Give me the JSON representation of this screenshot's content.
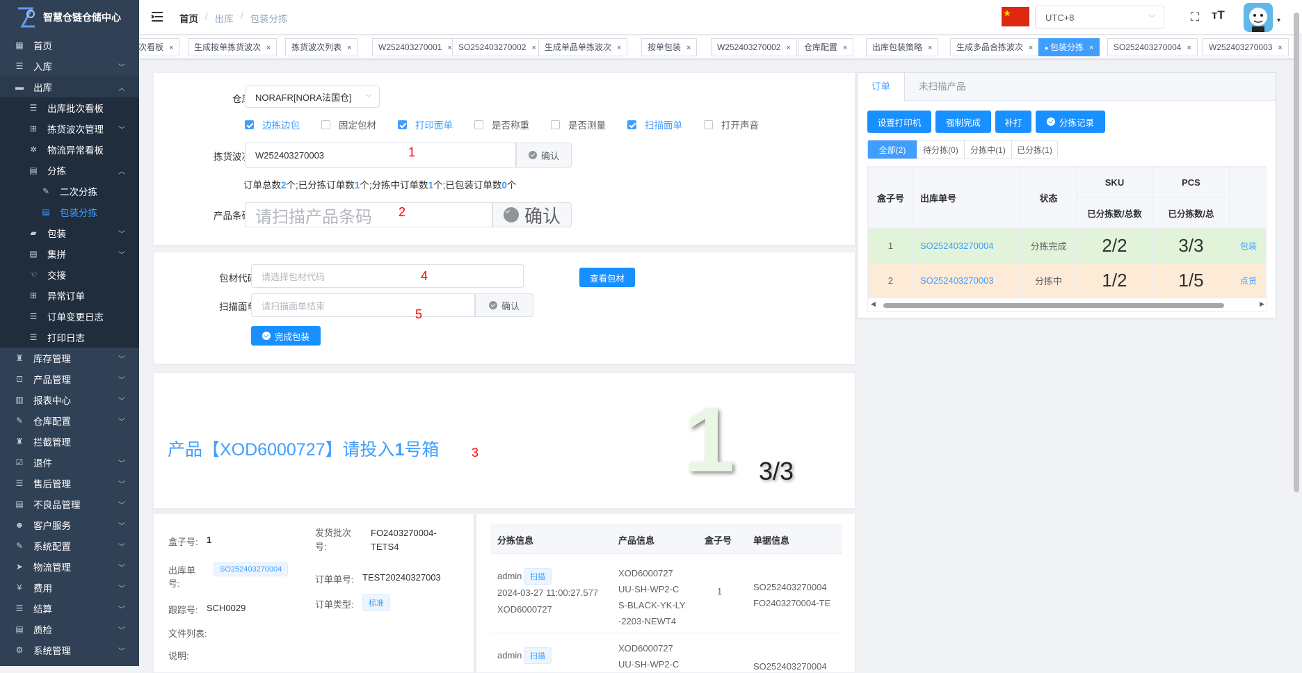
{
  "sidebar": {
    "title": "智慧仓链仓储中心",
    "items": [
      {
        "label": "首页",
        "icon": "dashboard-icon"
      },
      {
        "label": "入库",
        "icon": "list-icon"
      },
      {
        "label": "出库",
        "icon": "outbound-icon"
      },
      {
        "label": "出库批次看板",
        "icon": "list-icon"
      },
      {
        "label": "拣货波次管理",
        "icon": "grid-icon"
      },
      {
        "label": "物流异常看板",
        "icon": "bug-icon"
      },
      {
        "label": "分拣",
        "icon": "doc-icon"
      },
      {
        "label": "二次分拣",
        "icon": "edit-icon"
      },
      {
        "label": "包装分拣",
        "icon": "doc-icon"
      },
      {
        "label": "包装",
        "icon": "lock-icon"
      },
      {
        "label": "集拼",
        "icon": "doc-icon"
      },
      {
        "label": "交接",
        "icon": "hand-icon"
      },
      {
        "label": "异常订单",
        "icon": "grid-icon"
      },
      {
        "label": "订单变更日志",
        "icon": "list-icon"
      },
      {
        "label": "打印日志",
        "icon": "list-icon"
      },
      {
        "label": "库存管理",
        "icon": "stock-icon"
      },
      {
        "label": "产品管理",
        "icon": "box-icon"
      },
      {
        "label": "报表中心",
        "icon": "chart-icon"
      },
      {
        "label": "仓库配置",
        "icon": "edit-icon"
      },
      {
        "label": "拦截管理",
        "icon": "stock-icon"
      },
      {
        "label": "退件",
        "icon": "check-icon"
      },
      {
        "label": "售后管理",
        "icon": "list-icon"
      },
      {
        "label": "不良品管理",
        "icon": "doc-icon"
      },
      {
        "label": "客户服务",
        "icon": "user-icon"
      },
      {
        "label": "系统配置",
        "icon": "edit-icon"
      },
      {
        "label": "物流管理",
        "icon": "send-icon"
      },
      {
        "label": "费用",
        "icon": "yen-icon"
      },
      {
        "label": "结算",
        "icon": "list-icon"
      },
      {
        "label": "质检",
        "icon": "doc-icon"
      },
      {
        "label": "系统管理",
        "icon": "gear-icon"
      }
    ]
  },
  "header": {
    "breadcrumb": [
      "首页",
      "出库",
      "包装分拣"
    ],
    "timezone": "UTC+8"
  },
  "tabs": [
    "次看板",
    "生成按单拣货波次",
    "拣货波次列表",
    "W252403270001",
    "SO252403270002",
    "生成单品单拣波次",
    "按单包装",
    "W252403270002",
    "仓库配置",
    "出库包装策略",
    "生成多品合拣波次",
    "包装分拣",
    "SO252403270004",
    "W252403270003"
  ],
  "form": {
    "warehouse_label": "仓库",
    "warehouse_value": "NORAFR[NORA法国仓]",
    "checkboxes": [
      {
        "label": "边拣边包",
        "checked": true
      },
      {
        "label": "固定包材",
        "checked": false
      },
      {
        "label": "打印面单",
        "checked": true
      },
      {
        "label": "是否称重",
        "checked": false
      },
      {
        "label": "是否测量",
        "checked": false
      },
      {
        "label": "扫描面单",
        "checked": true
      },
      {
        "label": "打开声音",
        "checked": false
      }
    ],
    "wave_label": "拣货波次",
    "wave_value": "W252403270003",
    "confirm": "确认",
    "summary": {
      "t1": "订单总数",
      "total": "2",
      "t2": "个;已分拣订单数",
      "sorted": "1",
      "t3": "个;分拣中订单数",
      "sorting": "1",
      "t4": "个;已包装订单数",
      "packed": "0",
      "t5": "个"
    },
    "barcode_label": "产品条码",
    "barcode_placeholder": "请扫描产品条码",
    "marks": [
      "1",
      "2",
      "3",
      "4",
      "5"
    ]
  },
  "pack": {
    "material_label": "包材代码",
    "material_placeholder": "请选择包材代码",
    "view_material": "查看包材",
    "scan_label": "扫描面单",
    "scan_placeholder": "请扫描面单结束",
    "complete": "完成包装"
  },
  "prompt": {
    "message": "产品【XOD6000727】请投入",
    "box_num": "1",
    "suffix": "号箱",
    "big_num": "1",
    "progress": "3/3"
  },
  "detail": {
    "box_label": "盒子号:",
    "box_value": "1",
    "order_label": "出库单号:",
    "order_value": "SO252403270004",
    "track_label": "跟踪号:",
    "track_value": "SCH0029",
    "files_label": "文件列表:",
    "note_label": "说明:",
    "batch_label": "发货批次号:",
    "batch_value": "FO2403270004-TETS4",
    "ref_label": "订单单号:",
    "ref_value": "TEST20240327003",
    "type_label": "订单类型:",
    "type_value": "标准"
  },
  "log": {
    "headers": [
      "分拣信息",
      "产品信息",
      "盒子号",
      "单据信息"
    ],
    "rows": [
      {
        "user": "admin",
        "tag": "扫描",
        "time": "2024-03-27 11:00:27.577",
        "sku": "XOD6000727",
        "product": [
          "XOD6000727",
          "UU-SH-WP2-C",
          "S-BLACK-YK-LY",
          "-2203-NEWT4"
        ],
        "box": "1",
        "docs": [
          "SO252403270004",
          "FO2403270004-TE"
        ]
      },
      {
        "user": "admin",
        "tag": "扫描",
        "time": "",
        "sku": "",
        "product": [
          "XOD6000727",
          "UU-SH-WP2-C"
        ],
        "box": "",
        "docs": [
          "SO252403270004"
        ]
      }
    ]
  },
  "right": {
    "tabs": [
      "订单",
      "未扫描产品"
    ],
    "buttons": [
      "设置打印机",
      "强制完成",
      "补打",
      "分拣记录"
    ],
    "filters": [
      "全部(2)",
      "待分拣(0)",
      "分拣中(1)",
      "已分拣(1)"
    ],
    "headers": {
      "box": "盒子号",
      "order": "出库单号",
      "status": "状态",
      "sku": "SKU",
      "pcs": "PCS",
      "sku_sub": "已分拣数/总数",
      "pcs_sub": "已分拣数/总"
    },
    "rows": [
      {
        "box": "1",
        "order": "SO252403270004",
        "status": "分拣完成",
        "sku": "2/2",
        "pcs": "3/3",
        "action": "包装"
      },
      {
        "box": "2",
        "order": "SO252403270003",
        "status": "分拣中",
        "sku": "1/2",
        "pcs": "1/5",
        "action": "点货"
      }
    ]
  },
  "colors": {
    "primary": "#1890ff",
    "sidebar": "#304156",
    "done_row": "#e1f3d8",
    "sorting_row": "#fdebd8"
  }
}
